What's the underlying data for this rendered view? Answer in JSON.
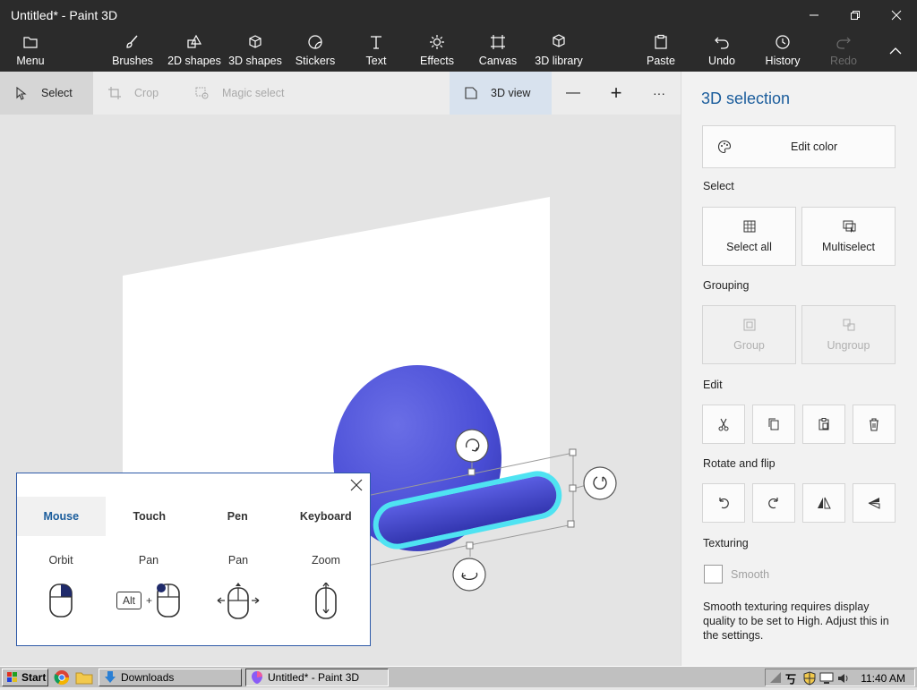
{
  "window": {
    "title": "Untitled* - Paint 3D"
  },
  "ribbon": {
    "menu": "Menu",
    "brushes": "Brushes",
    "shapes2d": "2D shapes",
    "shapes3d": "3D shapes",
    "stickers": "Stickers",
    "text": "Text",
    "effects": "Effects",
    "canvas": "Canvas",
    "library3d": "3D library",
    "paste": "Paste",
    "undo": "Undo",
    "history": "History",
    "redo": "Redo"
  },
  "toolbar": {
    "select": "Select",
    "crop": "Crop",
    "magic_select": "Magic select",
    "view3d": "3D view",
    "zoom_out": "—",
    "zoom_in": "+",
    "more": "···"
  },
  "panel": {
    "title": "3D selection",
    "edit_color": "Edit color",
    "select_label": "Select",
    "select_all": "Select all",
    "multiselect": "Multiselect",
    "grouping_label": "Grouping",
    "group": "Group",
    "ungroup": "Ungroup",
    "edit_label": "Edit",
    "rotate_label": "Rotate and flip",
    "texturing_label": "Texturing",
    "smooth": "Smooth",
    "smooth_note": "Smooth texturing requires display quality to be set to High. Adjust this in the settings."
  },
  "help": {
    "tabs": [
      "Mouse",
      "Touch",
      "Pen",
      "Keyboard"
    ],
    "actions": [
      "Orbit",
      "Pan",
      "Pan",
      "Zoom"
    ],
    "alt_key": "Alt",
    "plus": "+"
  },
  "taskbar": {
    "start": "Start",
    "downloads": "Downloads",
    "paint3d": "Untitled* - Paint 3D",
    "time": "11:40 AM"
  },
  "colors": {
    "titlebar": "#2b2b2b",
    "accent": "#1b5d9c",
    "sphere": "#4b4fd6",
    "highlight": "#4fe3f2"
  }
}
